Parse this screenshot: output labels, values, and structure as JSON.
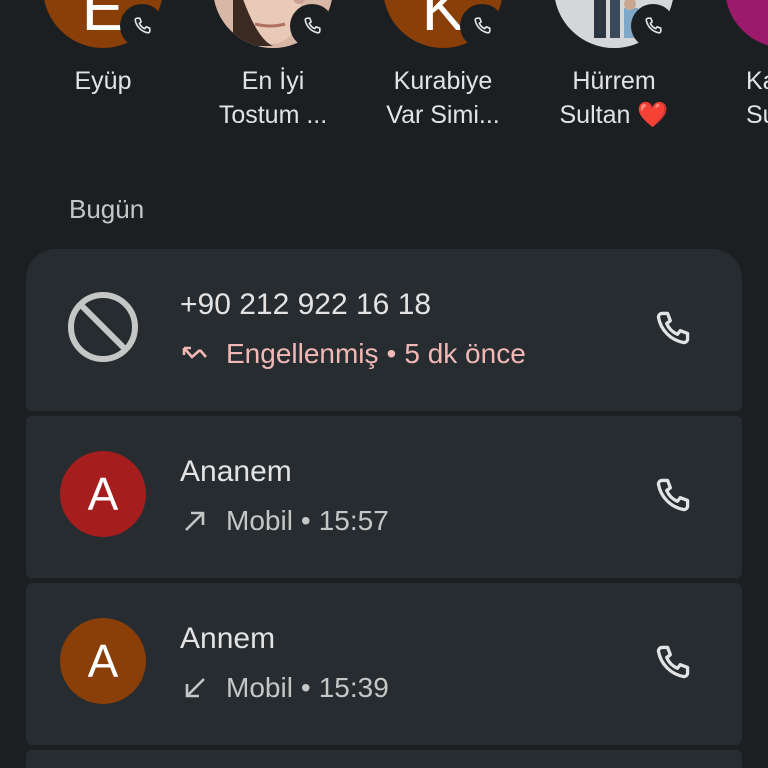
{
  "favorites": [
    {
      "name_line1": "Eyüp",
      "name_line2": "",
      "avatar_letter": "E",
      "avatar_color": "#8a3f08",
      "heart": false
    },
    {
      "name_line1": "En İyi",
      "name_line2": "Tostum ...",
      "avatar_letter": "",
      "avatar_color": "#d9b8a8",
      "heart": false
    },
    {
      "name_line1": "Kurabiye",
      "name_line2": "Var Simi...",
      "avatar_letter": "K",
      "avatar_color": "#8a3f08",
      "heart": false
    },
    {
      "name_line1": "Hürrem",
      "name_line2": "Sultan",
      "avatar_letter": "",
      "avatar_color": "#d8d8d8",
      "heart": true,
      "heart_glyph": "❤️"
    },
    {
      "name_line1": "Ka",
      "name_line2": "Sult",
      "avatar_letter": "",
      "avatar_color": "#9c1a6b",
      "heart": false
    }
  ],
  "section": {
    "title": "Bugün"
  },
  "calls": [
    {
      "title": "+90 212 922 16 18",
      "status": "Engellenmiş",
      "separator": "•",
      "time": "5 dk önce",
      "direction": "blocked",
      "avatar_type": "blocked-icon",
      "avatar_letter": "",
      "avatar_color": "",
      "status_color": "#f2b8b5"
    },
    {
      "title": "Ananem",
      "status": "Mobil",
      "separator": "•",
      "time": "15:57",
      "direction": "outgoing",
      "avatar_type": "letter",
      "avatar_letter": "A",
      "avatar_color": "#a51d1d",
      "status_color": "#c4c7c5"
    },
    {
      "title": "Annem",
      "status": "Mobil",
      "separator": "•",
      "time": "15:39",
      "direction": "incoming",
      "avatar_type": "letter",
      "avatar_letter": "A",
      "avatar_color": "#8a3f08",
      "status_color": "#c4c7c5"
    }
  ],
  "colors": {
    "background": "#1c1f22",
    "card": "#272c30",
    "blocked_text": "#f2b8b5",
    "secondary_text": "#c4c7c5",
    "primary_text": "#e3e3e3"
  },
  "icons": {
    "call_button": "phone-icon",
    "blocked": "block-icon",
    "outgoing": "call-made-icon",
    "incoming": "call-received-icon",
    "blocked_direction": "call-missed-icon"
  }
}
